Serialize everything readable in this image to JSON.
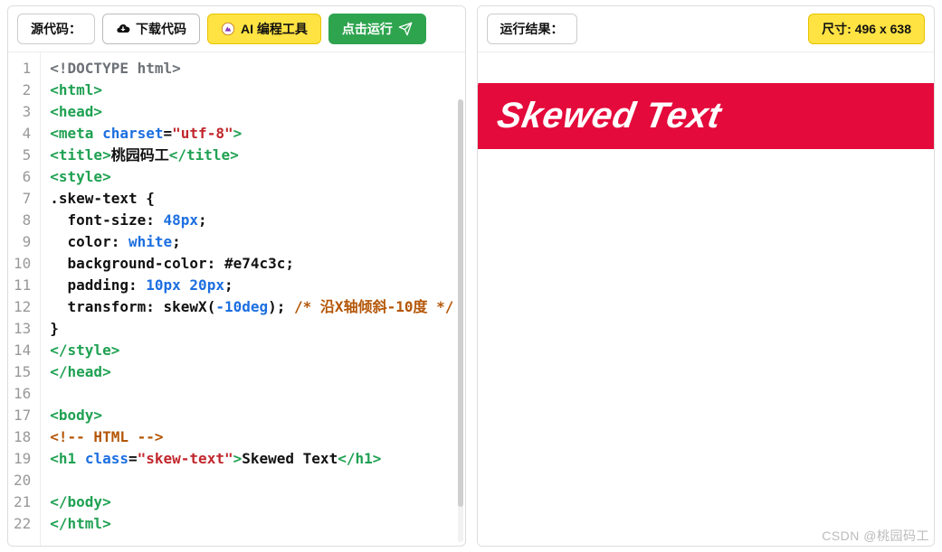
{
  "toolbar": {
    "source_label": "源代码：",
    "download_label": "下载代码",
    "ai_tool_label": "AI 编程工具",
    "run_label": "点击运行",
    "result_label": "运行结果：",
    "size_label": "尺寸: 496 x 638"
  },
  "code_lines": [
    {
      "n": 1,
      "html": "<span class='t-doctype'>&lt;!DOCTYPE html&gt;</span>"
    },
    {
      "n": 2,
      "html": "<span class='t-tag'>&lt;html&gt;</span>"
    },
    {
      "n": 3,
      "html": "<span class='t-tag'>&lt;head&gt;</span>"
    },
    {
      "n": 4,
      "html": "<span class='t-tag'>&lt;meta</span> <span class='t-attr'>charset</span><span class='t-punct'>=</span><span class='t-val'>\"utf-8\"</span><span class='t-tag'>&gt;</span>"
    },
    {
      "n": 5,
      "html": "<span class='t-tag'>&lt;title&gt;</span><span class='t-text'>桃园码工</span><span class='t-tag'>&lt;/title&gt;</span>"
    },
    {
      "n": 6,
      "html": "<span class='t-tag'>&lt;style&gt;</span>"
    },
    {
      "n": 7,
      "html": "<span class='t-sel'>.skew-text</span> <span class='t-punct'>{</span>"
    },
    {
      "n": 8,
      "html": "  <span class='t-prop'>font-size</span><span class='t-punct'>:</span> <span class='t-num'>48px</span><span class='t-punct'>;</span>"
    },
    {
      "n": 9,
      "html": "  <span class='t-prop'>color</span><span class='t-punct'>:</span> <span class='t-keyword'>white</span><span class='t-punct'>;</span>"
    },
    {
      "n": 10,
      "html": "  <span class='t-prop'>background-color</span><span class='t-punct'>:</span> <span class='t-hex'>#e74c3c</span><span class='t-punct'>;</span>"
    },
    {
      "n": 11,
      "html": "  <span class='t-prop'>padding</span><span class='t-punct'>:</span> <span class='t-num'>10px</span> <span class='t-num'>20px</span><span class='t-punct'>;</span>"
    },
    {
      "n": 12,
      "html": "  <span class='t-prop'>transform</span><span class='t-punct'>:</span> <span class='t-prop'>skewX</span><span class='t-punct'>(</span><span class='t-num'>-10deg</span><span class='t-punct'>);</span> <span class='t-comment'>/* 沿X轴倾斜-10度 */</span>"
    },
    {
      "n": 13,
      "html": "<span class='t-punct'>}</span>"
    },
    {
      "n": 14,
      "html": "<span class='t-tag'>&lt;/style&gt;</span>"
    },
    {
      "n": 15,
      "html": "<span class='t-tag'>&lt;/head&gt;</span>"
    },
    {
      "n": 16,
      "html": ""
    },
    {
      "n": 17,
      "html": "<span class='t-tag'>&lt;body&gt;</span>"
    },
    {
      "n": 18,
      "html": "<span class='t-htmlcomment'>&lt;!-- HTML --&gt;</span>"
    },
    {
      "n": 19,
      "html": "<span class='t-tag'>&lt;h1</span> <span class='t-attr'>class</span><span class='t-punct'>=</span><span class='t-val'>\"skew-text\"</span><span class='t-tag'>&gt;</span><span class='t-text'>Skewed Text</span><span class='t-tag'>&lt;/h1&gt;</span>"
    },
    {
      "n": 20,
      "html": ""
    },
    {
      "n": 21,
      "html": "<span class='t-tag'>&lt;/body&gt;</span>"
    },
    {
      "n": 22,
      "html": "<span class='t-tag'>&lt;/html&gt;</span>"
    }
  ],
  "result": {
    "skew_text": "Skewed Text"
  },
  "watermark": "CSDN @桃园码工"
}
